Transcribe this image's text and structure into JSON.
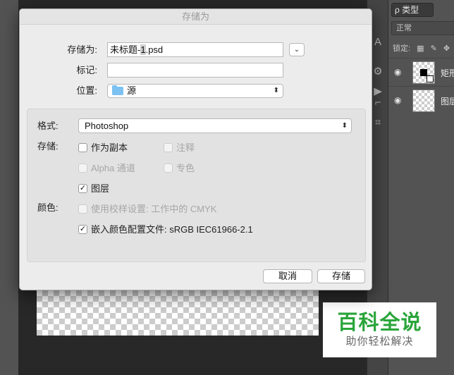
{
  "dialog": {
    "title": "存储为",
    "save_as_label": "存储为:",
    "filename_base": "未标题-",
    "filename_sel": "1",
    "filename_ext": ".psd",
    "tags_label": "标记:",
    "tags_value": "",
    "location_label": "位置:",
    "location_value": "源",
    "format_label": "格式:",
    "format_value": "Photoshop",
    "storage_label": "存储:",
    "color_label": "颜色:",
    "options": {
      "as_copy": {
        "label": "作为副本",
        "checked": false,
        "enabled": true
      },
      "notes": {
        "label": "注释",
        "checked": false,
        "enabled": false
      },
      "alpha_channels": {
        "label": "Alpha 通道",
        "checked": false,
        "enabled": false
      },
      "spot_colors": {
        "label": "专色",
        "checked": false,
        "enabled": false
      },
      "layers": {
        "label": "图层",
        "checked": true,
        "enabled": true
      },
      "use_proof_setup": {
        "label": "使用校样设置: 工作中的 CMYK",
        "checked": false,
        "enabled": false
      },
      "embed_profile": {
        "label": "嵌入颜色配置文件: sRGB IEC61966-2.1",
        "checked": true,
        "enabled": true
      }
    },
    "cancel_label": "取消",
    "save_label": "存储"
  },
  "layers_panel": {
    "filter_label": "ρ 类型",
    "blend_mode": "正常",
    "lock_label": "锁定:",
    "layers": [
      {
        "name": "矩形"
      },
      {
        "name": "图层"
      }
    ]
  },
  "watermark": {
    "title": "百科全说",
    "subtitle": "助你轻松解决"
  },
  "colors": {
    "dialog_bg": "#ececec",
    "ps_dark": "#282828",
    "ps_panel": "#535353",
    "watermark_green": "#2aa53a"
  }
}
